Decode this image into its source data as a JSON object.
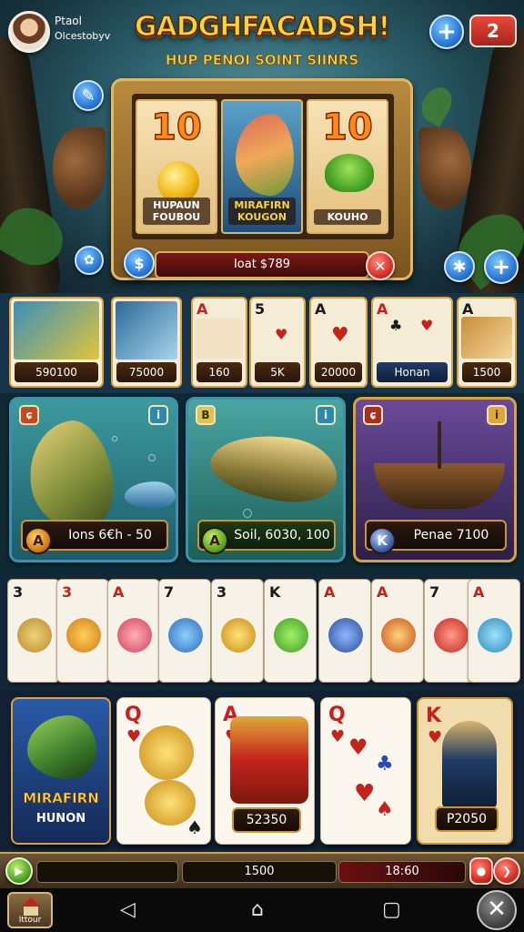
{
  "header": {
    "player_name": "Ptaol",
    "player_sub": "Olcestobyv",
    "title": "GADGHFACADSH!",
    "subtitle": "HUP PENOI SOINT SIINRS",
    "counter": "2",
    "plus_icon": "plus-icon"
  },
  "slot": {
    "reels": [
      {
        "number": "10",
        "label": "HUPAUN FOUBOU",
        "symbol": "gold-coin"
      },
      {
        "number": "",
        "label": "MIRAFIRN KOUGON",
        "symbol": "fish"
      },
      {
        "number": "10",
        "label": "KOUHO",
        "symbol": "frog"
      }
    ],
    "bet_label": "Ioat $789"
  },
  "card_strip": [
    {
      "value": "590100"
    },
    {
      "value": "75000"
    },
    {
      "rank": "A",
      "value": "160"
    },
    {
      "rank": "5",
      "value": "5K"
    },
    {
      "rank": "A",
      "value": "20000"
    },
    {
      "rank": "A",
      "value": "Honan"
    },
    {
      "rank": "A",
      "value": "1500"
    }
  ],
  "panels": [
    {
      "badge": "A",
      "text": "Ions 6€h - 50"
    },
    {
      "badge": "A",
      "text": "Soil, 6030, 100"
    },
    {
      "badge": "K",
      "text": "Penae 7100"
    }
  ],
  "row_cards": [
    {
      "rank": "3"
    },
    {
      "rank": "3"
    },
    {
      "rank": "A"
    },
    {
      "rank": "7"
    },
    {
      "rank": "3"
    },
    {
      "rank": "K"
    },
    {
      "rank": "A"
    },
    {
      "rank": "A"
    },
    {
      "rank": "7"
    },
    {
      "rank": "A"
    }
  ],
  "bottom_cards": [
    {
      "title": "MIRAFIRN",
      "subtitle": "HUNON"
    },
    {
      "rank": "Q"
    },
    {
      "rank": "A",
      "value": "52350"
    },
    {
      "rank": "Q"
    },
    {
      "rank": "K",
      "value": "P2050"
    }
  ],
  "status": {
    "balance": "1500",
    "win": "18:60"
  },
  "nav": {
    "home_label": "Ittour"
  },
  "colors": {
    "gold": "#ffd23a",
    "accent_blue": "#2a78d8",
    "accent_red": "#d8322a",
    "frame": "#b88a3e"
  }
}
